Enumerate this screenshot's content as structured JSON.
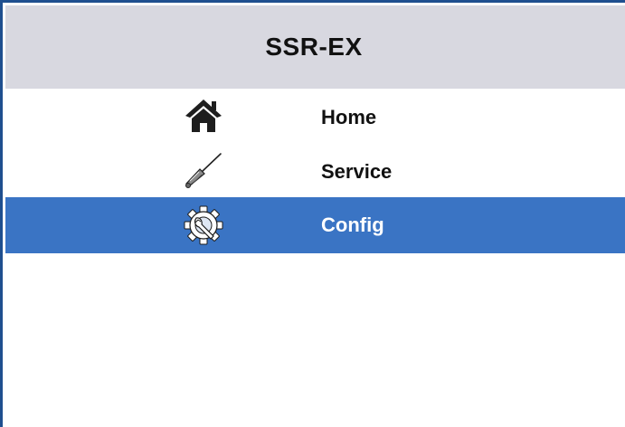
{
  "header": {
    "title": "SSR-EX"
  },
  "menu": {
    "items": [
      {
        "label": "Home",
        "icon": "home-icon",
        "selected": false
      },
      {
        "label": "Service",
        "icon": "screwdriver-icon",
        "selected": false
      },
      {
        "label": "Config",
        "icon": "gear-wrench-icon",
        "selected": true
      }
    ]
  },
  "colors": {
    "title_bar": "#d8d8e0",
    "selected": "#3a74c4",
    "border": "#1f4f8f"
  }
}
